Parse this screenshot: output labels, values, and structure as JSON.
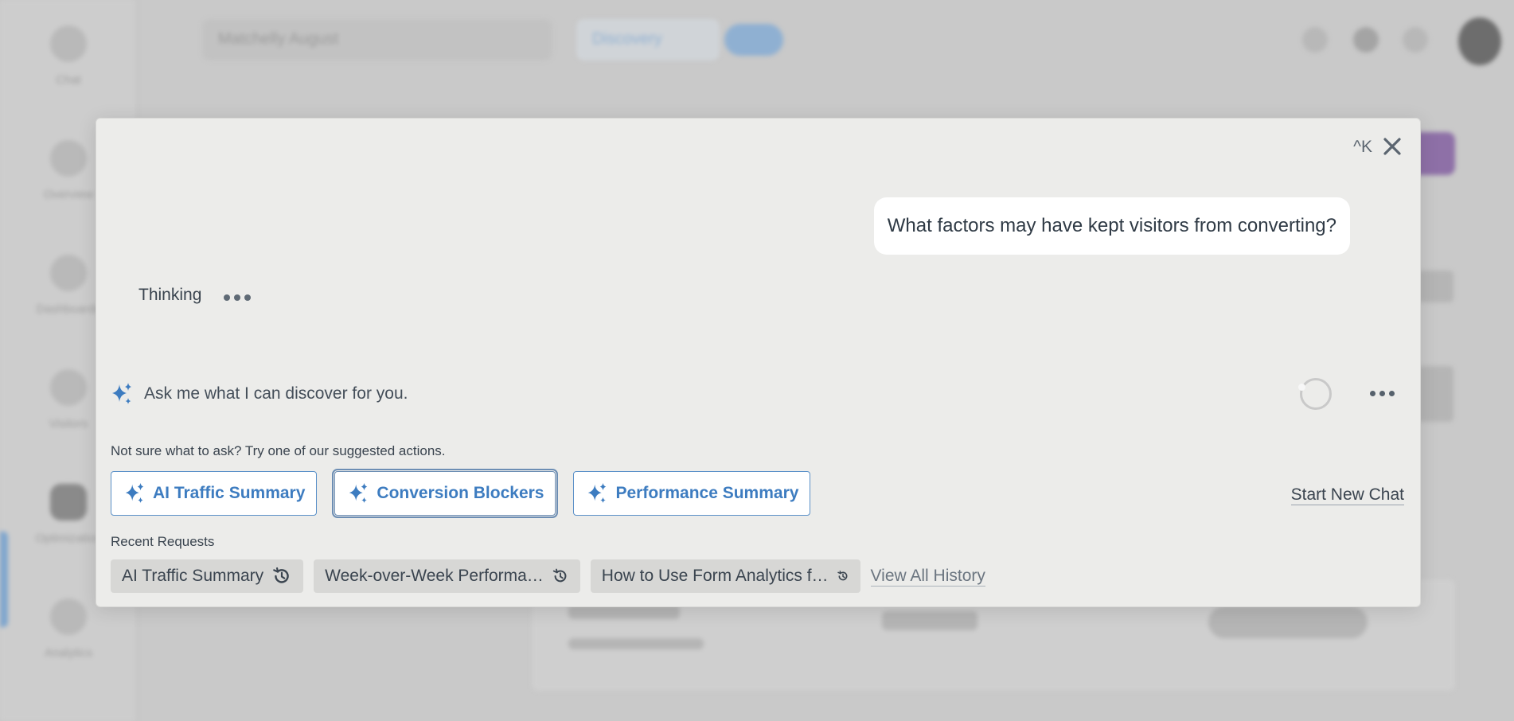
{
  "colors": {
    "accent": "#3d7cc0",
    "modal_bg": "#ececea",
    "overlay_bg": "#c9c9c9"
  },
  "background": {
    "workspace_name": "Matchelly August",
    "discovery_label": "Discovery",
    "nav_items": [
      "Chat",
      "Overview",
      "Dashboards",
      "Visitors",
      "Optimization",
      "Analytics"
    ]
  },
  "modal": {
    "shortcut": "^K",
    "close_icon": "close-icon",
    "user_message": "What factors may have kept visitors from converting?",
    "thinking_label": "Thinking",
    "ask_placeholder": "Ask me what I can discover for you.",
    "hint": "Not sure what to ask? Try one of our suggested actions.",
    "suggestions": [
      {
        "label": "AI Traffic Summary",
        "icon": "sparkle-icon"
      },
      {
        "label": "Conversion Blockers",
        "icon": "sparkle-icon"
      },
      {
        "label": "Performance Summary",
        "icon": "sparkle-icon"
      }
    ],
    "new_chat_label": "Start New Chat",
    "recent_label": "Recent Requests",
    "recent": [
      {
        "label": "AI Traffic Summary",
        "icon": "history-icon"
      },
      {
        "label": "Week-over-Week Performa…",
        "icon": "history-icon"
      },
      {
        "label": "How to Use Form Analytics f…",
        "icon": "history-icon"
      }
    ],
    "view_all_label": "View All History"
  }
}
